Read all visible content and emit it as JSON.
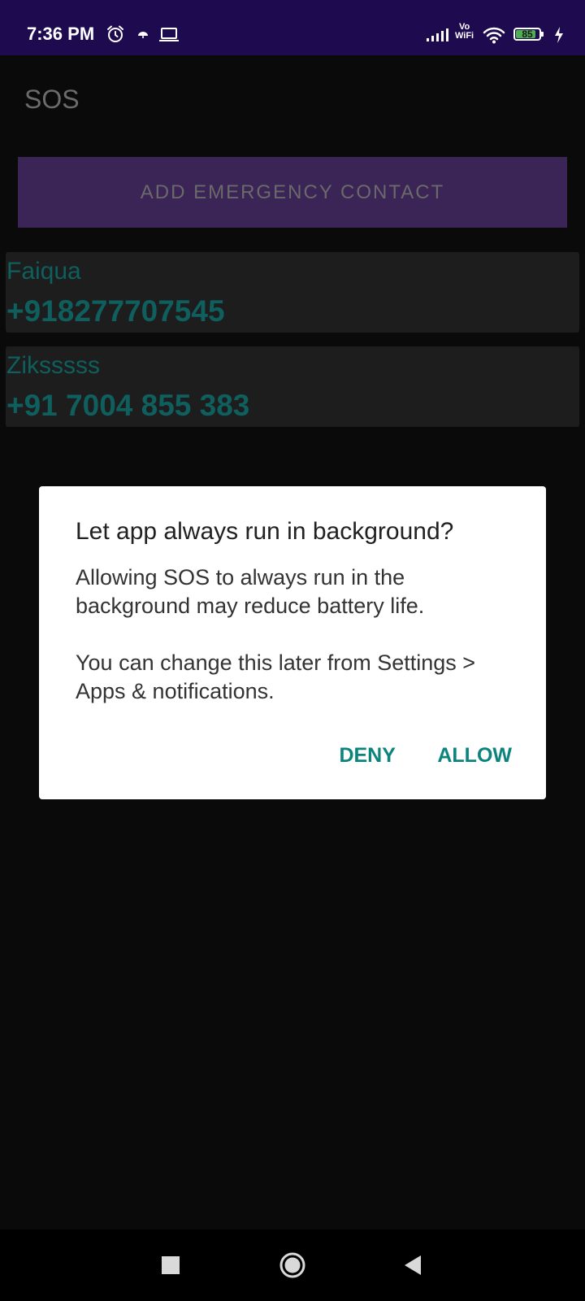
{
  "status_bar": {
    "time": "7:36 PM",
    "icons": [
      "alarm-icon",
      "cloud-icon",
      "laptop-icon",
      "signal-icon",
      "vowifi-icon",
      "wifi-icon",
      "battery-icon",
      "charging-icon"
    ],
    "vowifi_line1": "Vo",
    "vowifi_line2": "WiFi",
    "battery_level": "85",
    "battery_fraction": 0.85
  },
  "app": {
    "title": "SOS",
    "add_contact_label": "ADD EMERGENCY CONTACT",
    "accent_color": "#3b2456"
  },
  "contacts": [
    {
      "name": "Faiqua",
      "phone": "+918277707545"
    },
    {
      "name": "Ziksssss",
      "phone": "+91 7004 855 383"
    }
  ],
  "dialog": {
    "title": "Let app always run in background?",
    "message_1": "Allowing SOS to always run in the background may reduce battery life.",
    "message_2": "You can change this later from Settings > Apps & notifications.",
    "deny_label": "DENY",
    "allow_label": "ALLOW",
    "button_color": "#0b847e"
  },
  "nav_bar": {
    "icons": [
      "recents-icon",
      "home-icon",
      "back-icon"
    ]
  }
}
